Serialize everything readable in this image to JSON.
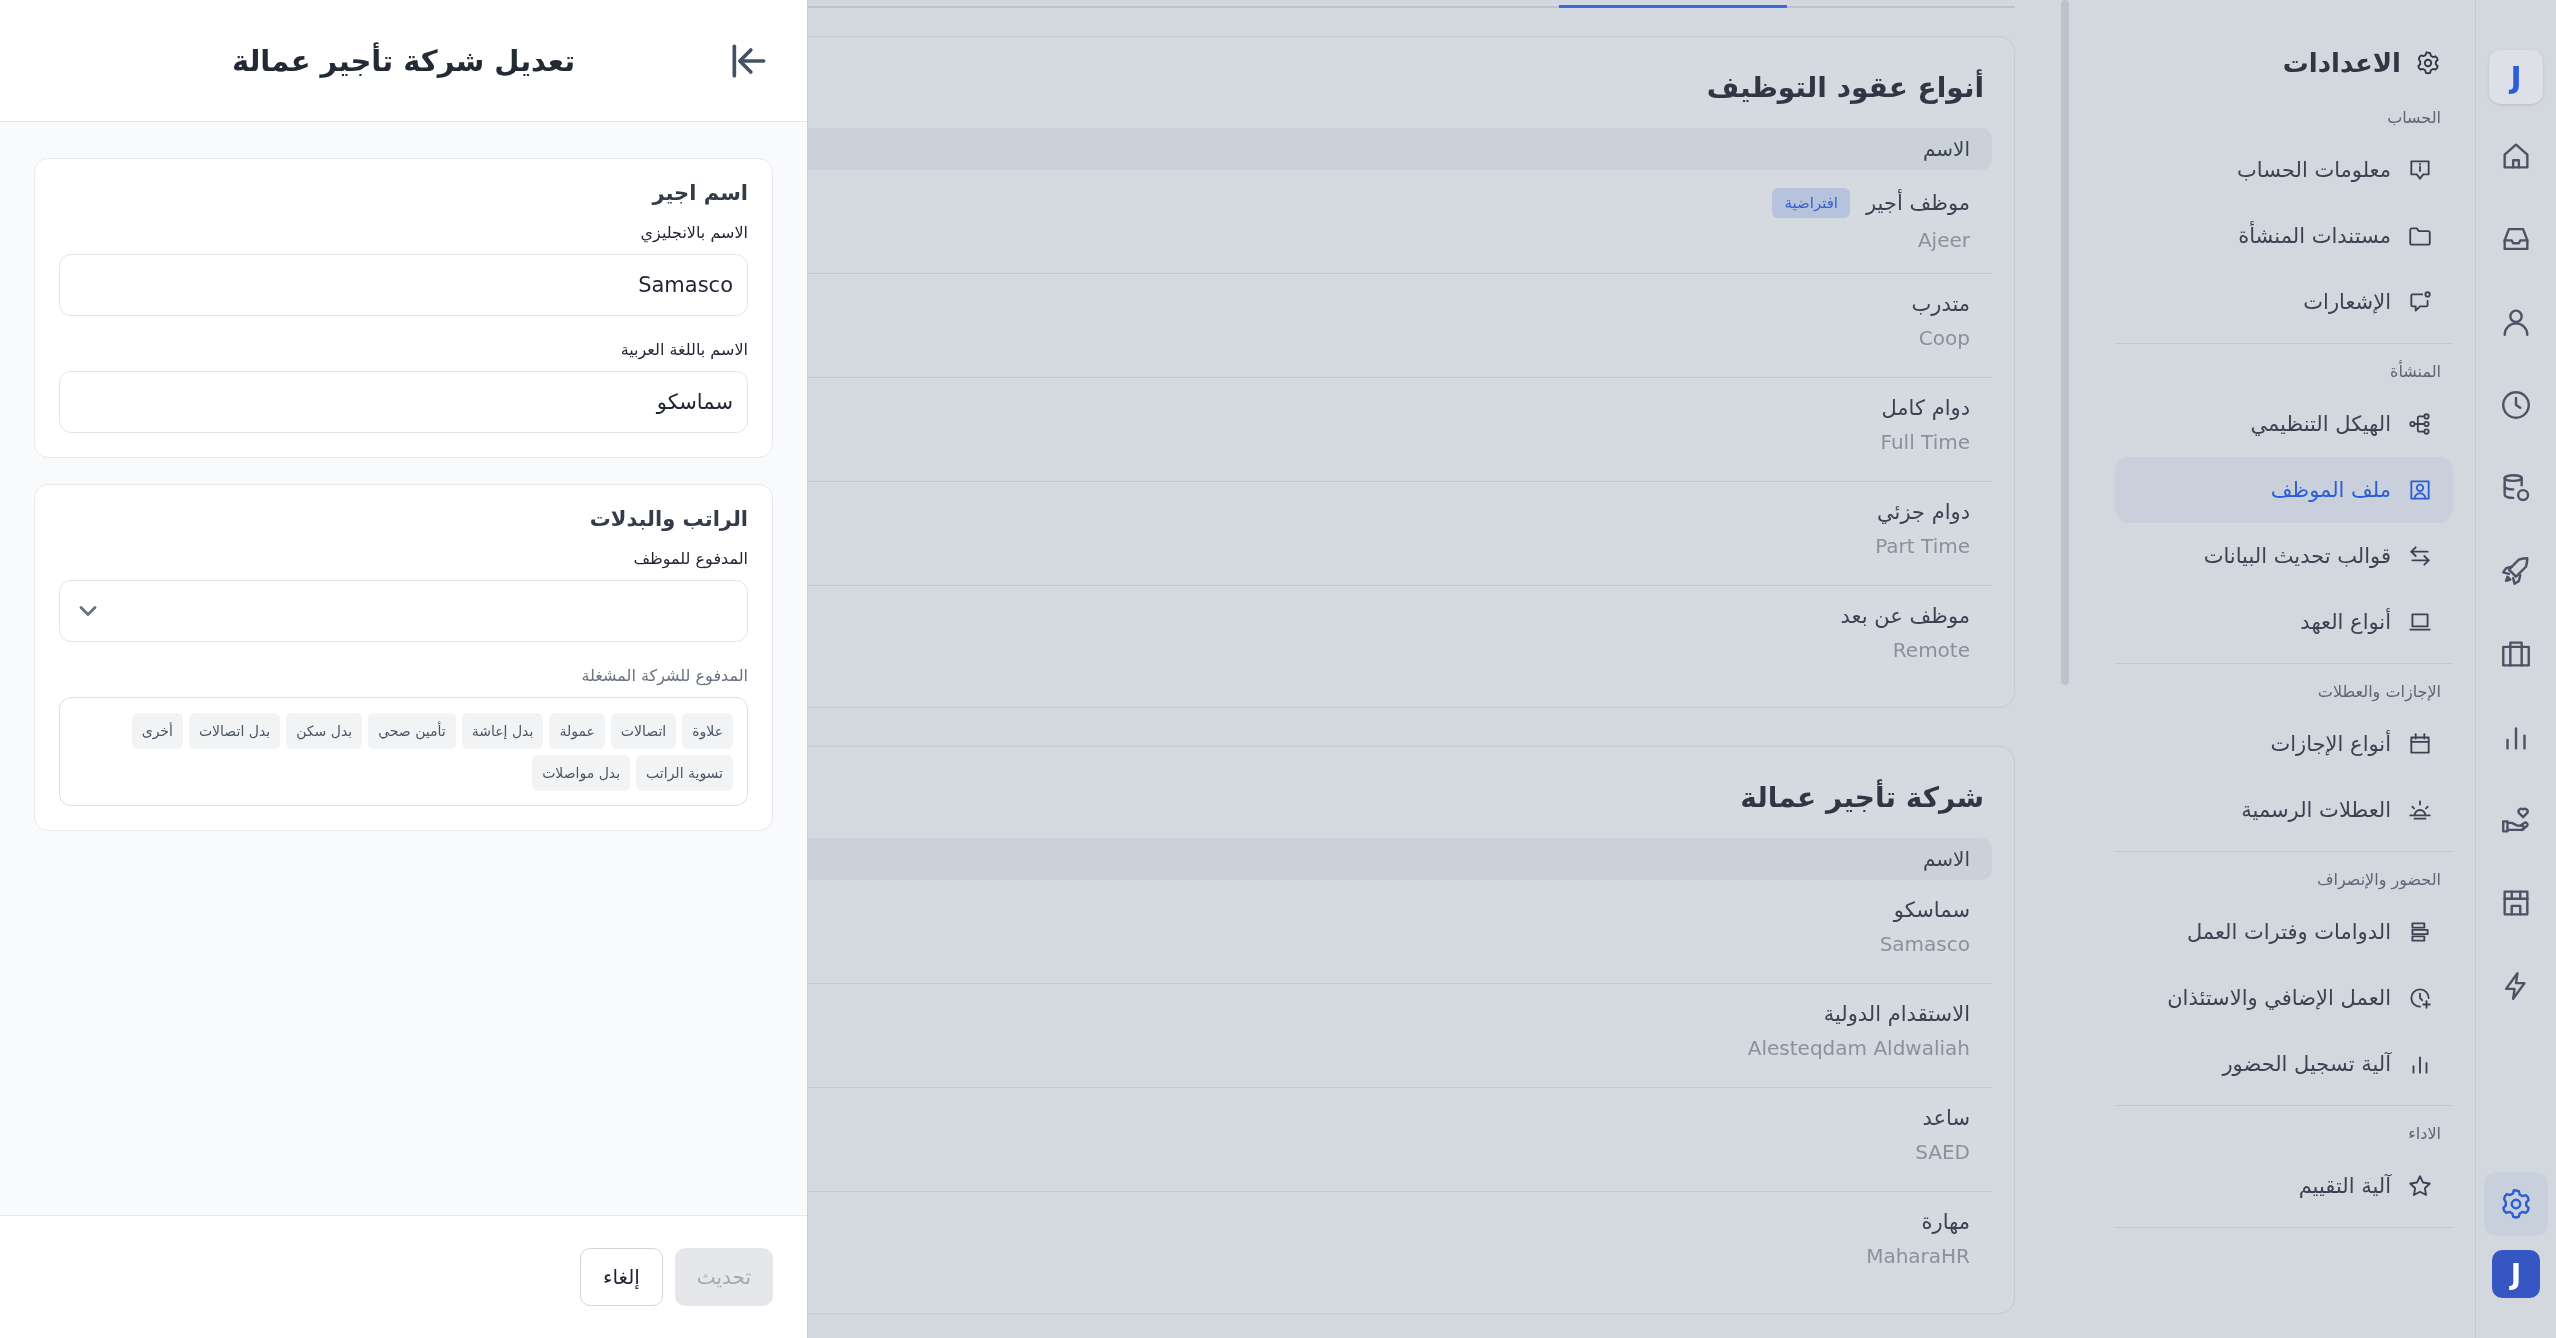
{
  "drawer": {
    "title": "تعديل شركة تأجير عمالة",
    "sections": [
      {
        "title": "اسم اجير",
        "fields": [
          {
            "kind": "text",
            "label": "الاسم بالانجليزي",
            "value": "Samasco"
          },
          {
            "kind": "text",
            "label": "الاسم باللغة العربية",
            "value": "سماسكو"
          }
        ]
      },
      {
        "title": "الراتب والبدلات",
        "fields": [
          {
            "kind": "select",
            "label": "المدفوع للموظف"
          },
          {
            "kind": "tags",
            "label": "المدفوع للشركة المشغلة",
            "tags": [
              "علاوة",
              "اتصالات",
              "عمولة",
              "بدل إعاشة",
              "تأمين صحي",
              "بدل سكن",
              "بدل اتصالات",
              "أخرى",
              "تسوية الراتب",
              "بدل مواصلات"
            ]
          }
        ]
      }
    ],
    "buttons": [
      {
        "label": "تحديث",
        "disabled": true
      },
      {
        "label": "إلغاء",
        "disabled": false
      }
    ]
  },
  "tabs": [
    {
      "selected": false
    },
    {
      "selected": true
    },
    {
      "selected": false
    }
  ],
  "cards": [
    {
      "title": "أنواع عقود التوظيف",
      "column": "الاسم",
      "rows": [
        {
          "name": "موظف أجير",
          "name_en": "Ajeer",
          "badge": "افتراضية"
        },
        {
          "name": "متدرب",
          "name_en": "Coop"
        },
        {
          "name": "دوام كامل",
          "name_en": "Full Time"
        },
        {
          "name": "دوام جزئي",
          "name_en": "Part Time"
        },
        {
          "name": "موظف عن بعد",
          "name_en": "Remote"
        }
      ]
    },
    {
      "title": "شركة تأجير عمالة",
      "column": "الاسم",
      "rows": [
        {
          "name": "سماسكو",
          "name_en": "Samasco"
        },
        {
          "name": "الاستقدام الدولية",
          "name_en": "Alesteqdam Aldwaliah"
        },
        {
          "name": "ساعد",
          "name_en": "SAED"
        },
        {
          "name": "مهارة",
          "name_en": "MaharaHR"
        }
      ]
    }
  ],
  "sidebar": {
    "title": "الاعدادات",
    "groups": [
      {
        "heading": "الحساب",
        "items": [
          {
            "label": "معلومات الحساب",
            "selected": false
          },
          {
            "label": "مستندات المنشأة",
            "selected": false
          },
          {
            "label": "الإشعارات",
            "selected": false
          }
        ]
      },
      {
        "heading": "المنشأة",
        "items": [
          {
            "label": "الهيكل التنظيمي",
            "selected": false
          },
          {
            "label": "ملف الموظف",
            "selected": true
          },
          {
            "label": "قوالب تحديث البيانات",
            "selected": false
          },
          {
            "label": "أنواع العهد",
            "selected": false
          }
        ]
      },
      {
        "heading": "الإجازات والعطلات",
        "items": [
          {
            "label": "أنواع الإجازات",
            "selected": false
          },
          {
            "label": "العطلات الرسمية",
            "selected": false
          }
        ]
      },
      {
        "heading": "الحضور والإنصراف",
        "items": [
          {
            "label": "الدوامات وفترات العمل",
            "selected": false
          },
          {
            "label": "العمل الإضافي والاستئذان",
            "selected": false
          },
          {
            "label": "آلية تسجيل الحضور",
            "selected": false
          }
        ]
      },
      {
        "heading": "الاداء",
        "items": [
          {
            "label": "آلية التقييم",
            "selected": false
          }
        ]
      }
    ]
  },
  "rail": {
    "logo": "J",
    "top_items": [
      {
        "selected": false
      },
      {
        "selected": false
      },
      {
        "selected": false
      },
      {
        "selected": false
      },
      {
        "selected": false
      },
      {
        "selected": false
      },
      {
        "selected": false
      },
      {
        "selected": false
      },
      {
        "selected": false
      },
      {
        "selected": false
      },
      {
        "selected": false
      }
    ],
    "bottom_items": [
      {
        "selected": true
      }
    ],
    "app_logo": "J"
  }
}
